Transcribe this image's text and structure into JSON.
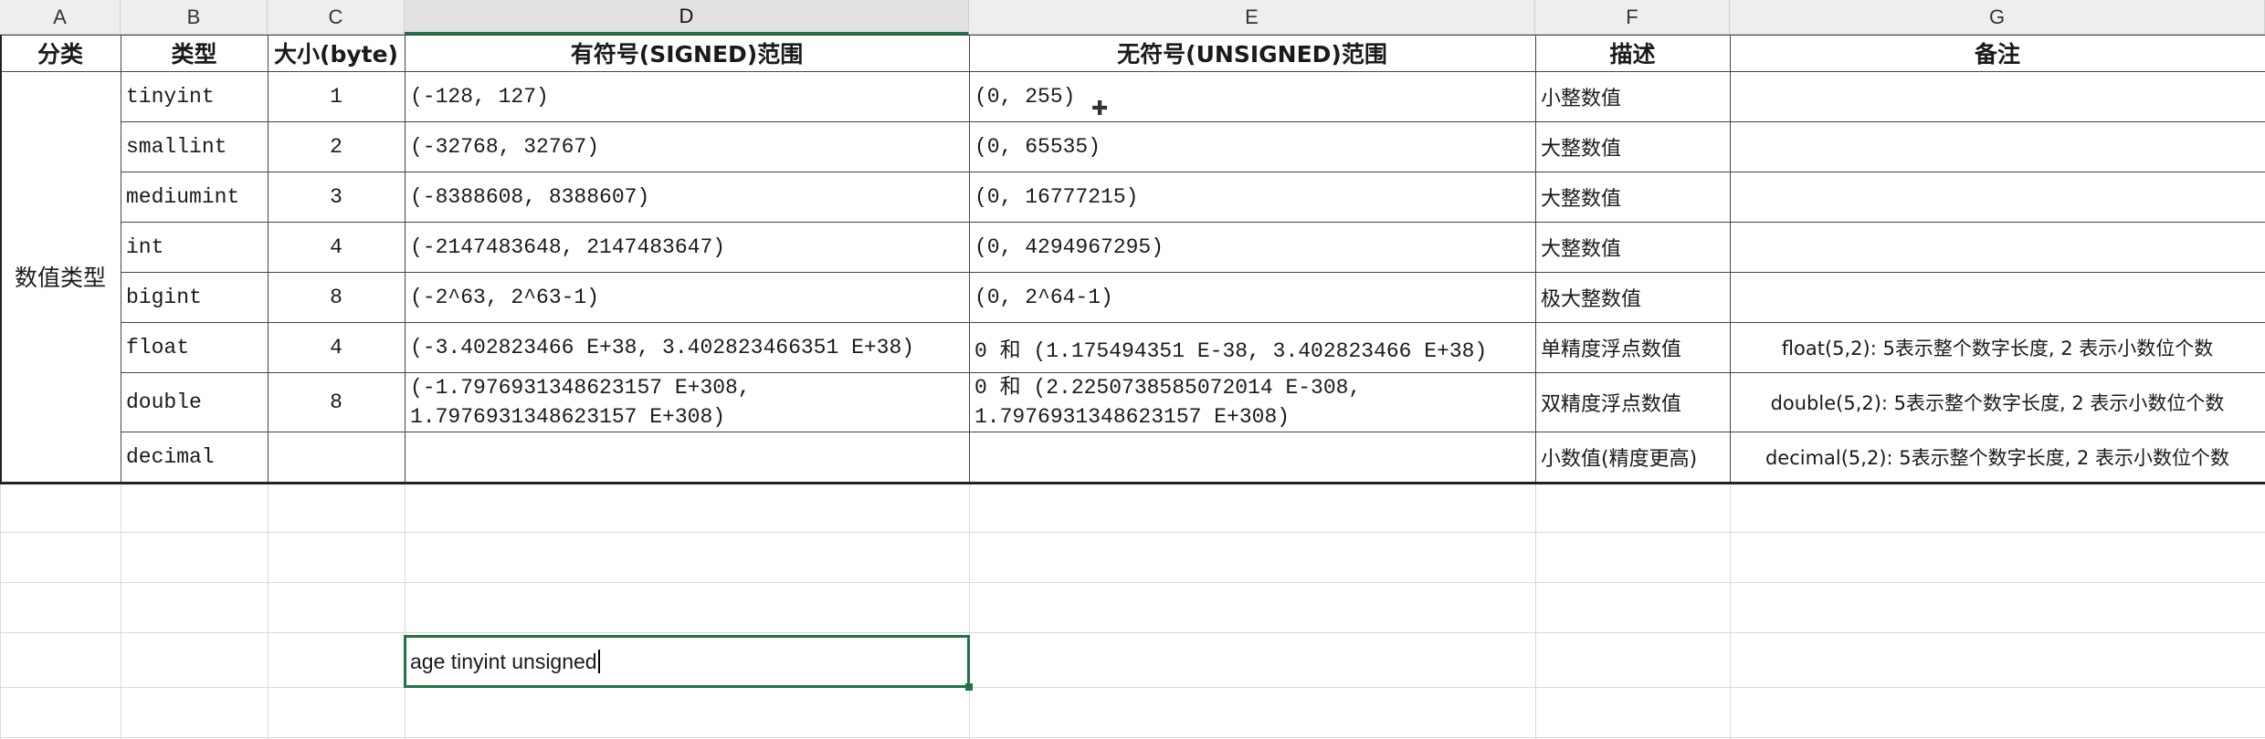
{
  "columns": [
    "A",
    "B",
    "C",
    "D",
    "E",
    "F",
    "G"
  ],
  "table": {
    "headers": [
      "分类",
      "类型",
      "大小(byte)",
      "有符号(SIGNED)范围",
      "无符号(UNSIGNED)范围",
      "描述",
      "备注"
    ],
    "category": "数值类型",
    "rows": [
      {
        "type": "tinyint",
        "size": "1",
        "signed": "(-128, 127)",
        "unsigned": "(0, 255)",
        "desc": "小整数值",
        "note": ""
      },
      {
        "type": "smallint",
        "size": "2",
        "signed": "(-32768, 32767)",
        "unsigned": "(0, 65535)",
        "desc": "大整数值",
        "note": ""
      },
      {
        "type": "mediumint",
        "size": "3",
        "signed": "(-8388608, 8388607)",
        "unsigned": "(0, 16777215)",
        "desc": "大整数值",
        "note": ""
      },
      {
        "type": "int",
        "size": "4",
        "signed": "(-2147483648, 2147483647)",
        "unsigned": "(0, 4294967295)",
        "desc": "大整数值",
        "note": ""
      },
      {
        "type": "bigint",
        "size": "8",
        "signed": "(-2^63, 2^63-1)",
        "unsigned": "(0, 2^64-1)",
        "desc": "极大整数值",
        "note": ""
      },
      {
        "type": "float",
        "size": "4",
        "signed": "(-3.402823466 E+38, 3.402823466351 E+38)",
        "unsigned": "0 和 (1.175494351 E-38, 3.402823466 E+38)",
        "desc": "单精度浮点数值",
        "note": "float(5,2): 5表示整个数字长度, 2 表示小数位个数"
      },
      {
        "type": "double",
        "size": "8",
        "signed": "(-1.7976931348623157 E+308, 1.7976931348623157 E+308)",
        "unsigned": "0 和 (2.2250738585072014 E-308, 1.7976931348623157 E+308)",
        "desc": "双精度浮点数值",
        "note": "double(5,2): 5表示整个数字长度, 2 表示小数位个数"
      },
      {
        "type": "decimal",
        "size": "",
        "signed": "",
        "unsigned": "",
        "desc": "小数值(精度更高)",
        "note": "decimal(5,2): 5表示整个数字长度, 2 表示小数位个数"
      }
    ]
  },
  "editing_cell": {
    "value": "age tinyint unsigned"
  },
  "colors": {
    "accent": "#217346",
    "header_bg": "#eeeeee",
    "gridline": "#d9d9d9"
  }
}
